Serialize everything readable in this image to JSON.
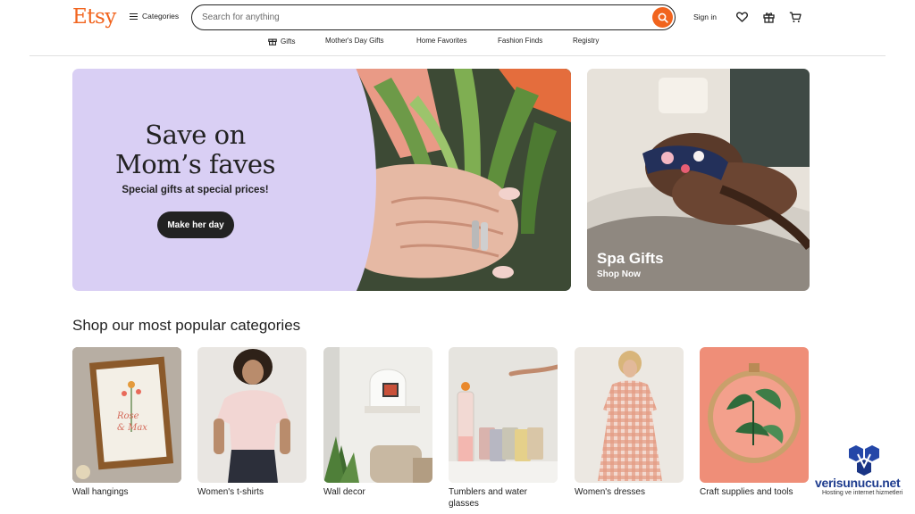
{
  "header": {
    "logo": "Etsy",
    "categories_label": "Categories",
    "search_placeholder": "Search for anything",
    "signin_label": "Sign in",
    "icons": [
      "hamburger-icon",
      "search-icon",
      "heart-icon",
      "gift-icon",
      "cart-icon"
    ]
  },
  "nav": {
    "items": [
      {
        "label": "Gifts",
        "icon": "gift-icon"
      },
      {
        "label": "Mother's Day Gifts"
      },
      {
        "label": "Home Favorites"
      },
      {
        "label": "Fashion Finds"
      },
      {
        "label": "Registry"
      }
    ]
  },
  "hero": {
    "title_line1": "Save on",
    "title_line2": "Mom’s faves",
    "subtitle": "Special gifts at special prices!",
    "button_label": "Make her day"
  },
  "spa": {
    "title": "Spa Gifts",
    "link": "Shop Now"
  },
  "categories": {
    "title": "Shop our most popular categories",
    "items": [
      {
        "label": "Wall hangings"
      },
      {
        "label": "Women's t-shirts"
      },
      {
        "label": "Wall decor"
      },
      {
        "label": "Tumblers and water glasses"
      },
      {
        "label": "Women's dresses"
      },
      {
        "label": "Craft supplies and tools"
      }
    ]
  },
  "watermark": {
    "brand": "verisunucu.net",
    "tagline": "Hosting ve internet hizmetleri"
  },
  "colors": {
    "brand_orange": "#f1641e",
    "hero_lavender": "#d9cff4",
    "text": "#222222",
    "watermark_blue": "#1f3d8f"
  }
}
